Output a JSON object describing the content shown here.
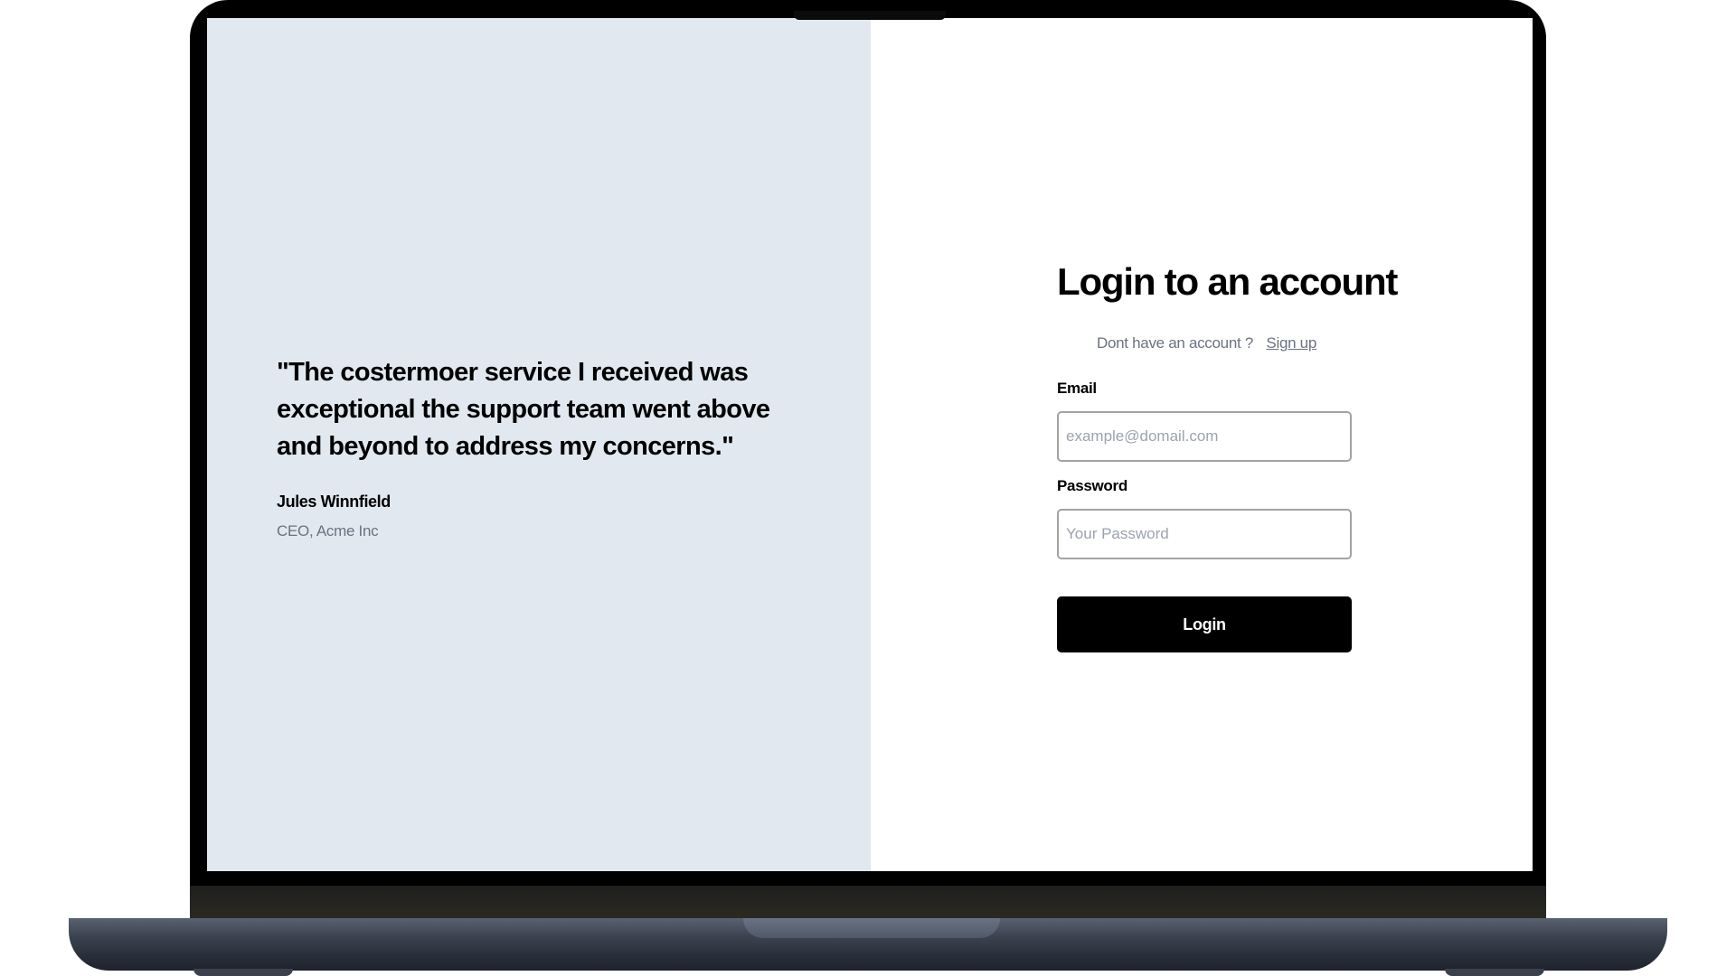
{
  "testimonial": {
    "quote": "\"The costermoer service I received was exceptional the support team went above and beyond to address my concerns.\"",
    "author": "Jules Winnfield",
    "role": "CEO, Acme Inc"
  },
  "login": {
    "title": "Login to an account",
    "signup_prompt": "Dont have an account ?",
    "signup_link": "Sign up",
    "email_label": "Email",
    "email_placeholder": "example@domail.com",
    "email_value": "",
    "password_label": "Password",
    "password_placeholder": "Your Password",
    "password_value": "",
    "submit_label": "Login"
  },
  "colors": {
    "left_panel_bg": "#e2e8f0",
    "button_bg": "#000000",
    "muted_text": "#6b7280"
  }
}
